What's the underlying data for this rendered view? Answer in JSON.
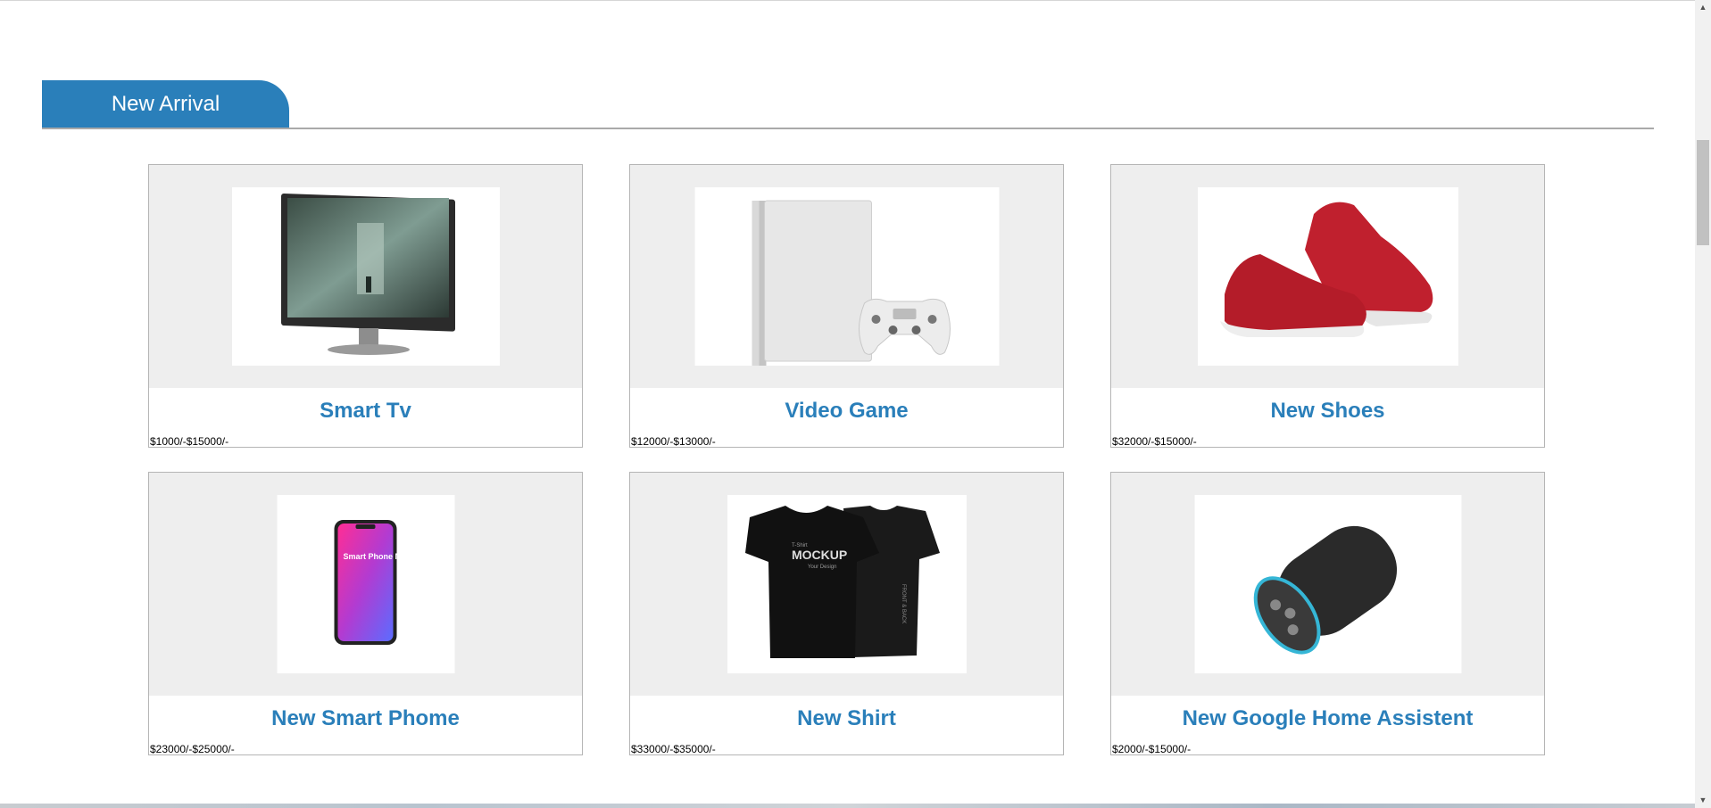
{
  "section": {
    "title": "New Arrival"
  },
  "products": [
    {
      "name": "Smart Tv",
      "price": "$1000/-$15000/-",
      "icon": "monitor-image"
    },
    {
      "name": "Video Game",
      "price": "$12000/-$13000/-",
      "icon": "game-console-image"
    },
    {
      "name": "New Shoes",
      "price": "$32000/-$15000/-",
      "icon": "sneakers-image"
    },
    {
      "name": "New Smart Phome",
      "price": "$23000/-$25000/-",
      "icon": "smartphone-image"
    },
    {
      "name": "New Shirt",
      "price": "$33000/-$35000/-",
      "icon": "tshirt-image"
    },
    {
      "name": "New Google Home Assistent",
      "price": "$2000/-$15000/-",
      "icon": "smart-speaker-image"
    }
  ],
  "product_images": {
    "phone_mockup_text": "Smart Phone Mockup Psd",
    "shirt_mockup_text": "MOCKUP",
    "shirt_mockup_small": "T-Shirt",
    "shirt_mockup_sub": "Your Design",
    "shirt_back_text": "FRONT & BACK"
  },
  "colors": {
    "accent": "#2a7fba",
    "card_media_bg": "#eeeeee",
    "card_border": "#b5b5b5"
  }
}
